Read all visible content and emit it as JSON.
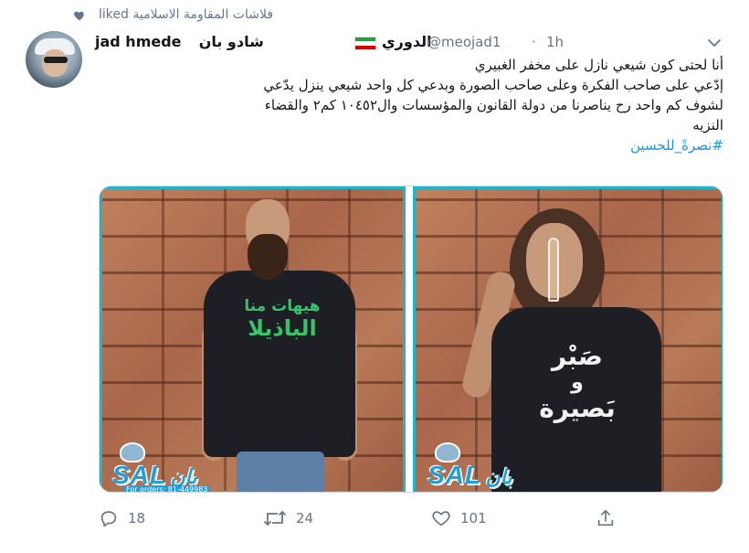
{
  "social_context": {
    "text": "فلاشات المقاومة الاسلامية liked",
    "icon": "heart-icon"
  },
  "tweet": {
    "display_name_left": "jad hmede",
    "display_name_right": "شادو بان",
    "display_name_tail": "الدوري",
    "flag": "iran-flag-icon",
    "handle": "@meojad1",
    "separator": "·",
    "timestamp": "1h",
    "text_lines": [
      "أنا لحتى كون شيعي نازل على مخفر الغبيري",
      "إدّعي على صاحب الفكرة وعلى صاحب الصورة وبدعي كل واحد شيعي ينزل يدّعي",
      "لشوف كم واحد رح يناصرنا من دولة القانون والمؤسسات وال١٠٤٥٢ كم٢ والقضاء",
      "النزيه"
    ],
    "hashtag": "#نصرةً_للحسين"
  },
  "media": {
    "left_photo": {
      "shirt_print_line1": "هيهات منا",
      "shirt_print_line2": "الباذيلا"
    },
    "right_photo": {
      "shirt_print_line1": "صَبْر",
      "shirt_print_line2": "و",
      "shirt_print_line3": "بَصيرة"
    },
    "logo_text": "SAL",
    "logo_suffix": "بان",
    "orders_text": "For orders: 81-449983"
  },
  "actions": {
    "reply_count": "18",
    "retweet_count": "24",
    "like_count": "101"
  },
  "colors": {
    "link": "#1b95e0",
    "muted": "#657786",
    "frame": "#21b3c8"
  }
}
